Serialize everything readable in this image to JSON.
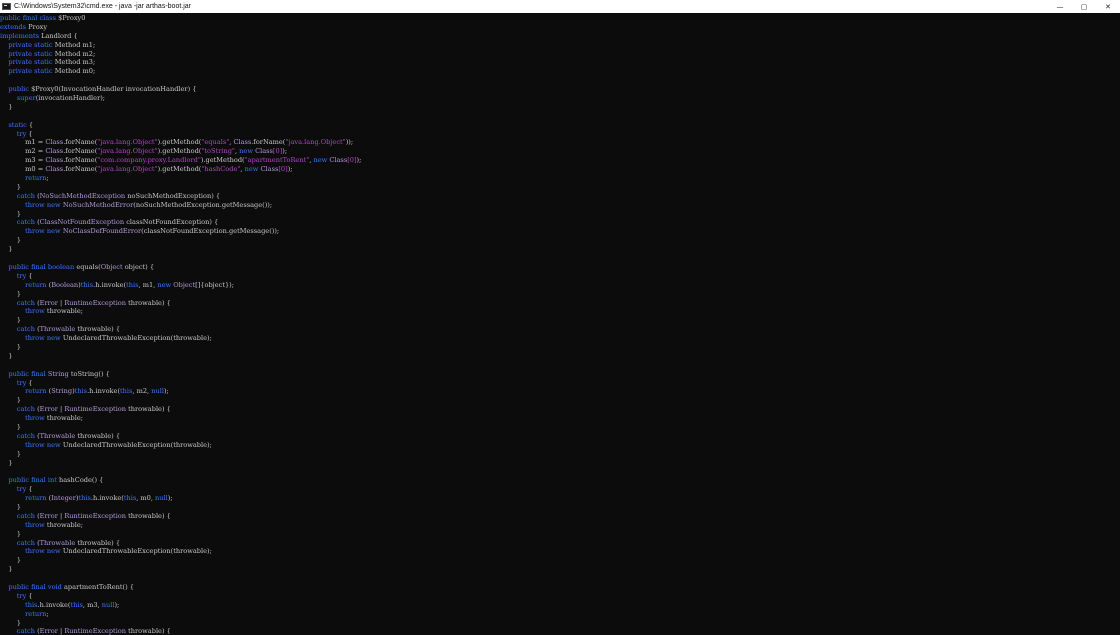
{
  "window": {
    "title": "C:\\Windows\\System32\\cmd.exe - java  -jar arthas-boot.jar",
    "controls": {
      "minimize": "—",
      "maximize": "▢",
      "close": "✕"
    }
  },
  "colors": {
    "keyword": "#3b78ff",
    "string": "#b148c6",
    "type": "#b49cdc",
    "plain": "#c8c8c8",
    "background": "#0c0c0c"
  },
  "code_lines": [
    [
      [
        "k",
        "public final class "
      ],
      [
        "p",
        "$Proxy0"
      ]
    ],
    [
      [
        "k",
        "extends "
      ],
      [
        "p",
        "Proxy"
      ]
    ],
    [
      [
        "k",
        "implements "
      ],
      [
        "p",
        "Landlord {"
      ]
    ],
    [
      [
        "k",
        "    private static "
      ],
      [
        "p",
        "Method m1;"
      ]
    ],
    [
      [
        "k",
        "    private static "
      ],
      [
        "p",
        "Method m2;"
      ]
    ],
    [
      [
        "k",
        "    private static "
      ],
      [
        "p",
        "Method m3;"
      ]
    ],
    [
      [
        "k",
        "    private static "
      ],
      [
        "p",
        "Method m0;"
      ]
    ],
    [],
    [
      [
        "k",
        "    public "
      ],
      [
        "p",
        "$Proxy0(InvocationHandler invocationHandler) {"
      ]
    ],
    [
      [
        "k",
        "        super"
      ],
      [
        "p",
        "(invocationHandler);"
      ]
    ],
    [
      [
        "p",
        "    }"
      ]
    ],
    [],
    [
      [
        "k",
        "    static "
      ],
      [
        "p",
        "{"
      ]
    ],
    [
      [
        "k",
        "        try "
      ],
      [
        "p",
        "{"
      ]
    ],
    [
      [
        "p",
        "            m1 = "
      ],
      [
        "t",
        "Class"
      ],
      [
        "p",
        ".forName("
      ],
      [
        "s",
        "\"java.lang.Object\""
      ],
      [
        "p",
        ").getMethod("
      ],
      [
        "s",
        "\"equals\""
      ],
      [
        "p",
        ", "
      ],
      [
        "t",
        "Class"
      ],
      [
        "p",
        ".forName("
      ],
      [
        "s",
        "\"java.lang.Object\""
      ],
      [
        "p",
        "));"
      ]
    ],
    [
      [
        "p",
        "            m2 = "
      ],
      [
        "t",
        "Class"
      ],
      [
        "p",
        ".forName("
      ],
      [
        "s",
        "\"java.lang.Object\""
      ],
      [
        "p",
        ").getMethod("
      ],
      [
        "s",
        "\"toString\""
      ],
      [
        "p",
        ", "
      ],
      [
        "k",
        "new "
      ],
      [
        "t",
        "Class"
      ],
      [
        "s",
        "[0]"
      ],
      [
        "p",
        ");"
      ]
    ],
    [
      [
        "p",
        "            m3 = "
      ],
      [
        "t",
        "Class"
      ],
      [
        "p",
        ".forName("
      ],
      [
        "s",
        "\"com.company.proxy.Landlord\""
      ],
      [
        "p",
        ").getMethod("
      ],
      [
        "s",
        "\"apartmentToRent\""
      ],
      [
        "p",
        ", "
      ],
      [
        "k",
        "new "
      ],
      [
        "t",
        "Class"
      ],
      [
        "s",
        "[0]"
      ],
      [
        "p",
        ");"
      ]
    ],
    [
      [
        "p",
        "            m0 = "
      ],
      [
        "t",
        "Class"
      ],
      [
        "p",
        ".forName("
      ],
      [
        "s",
        "\"java.lang.Object\""
      ],
      [
        "p",
        ").getMethod("
      ],
      [
        "s",
        "\"hashCode\""
      ],
      [
        "p",
        ", "
      ],
      [
        "k",
        "new "
      ],
      [
        "t",
        "Class"
      ],
      [
        "s",
        "[0]"
      ],
      [
        "p",
        ");"
      ]
    ],
    [
      [
        "k",
        "            return"
      ],
      [
        "p",
        ";"
      ]
    ],
    [
      [
        "p",
        "        }"
      ]
    ],
    [
      [
        "k",
        "        catch "
      ],
      [
        "p",
        "("
      ],
      [
        "t",
        "NoSuchMethodException"
      ],
      [
        "p",
        " noSuchMethodException) {"
      ]
    ],
    [
      [
        "k",
        "            throw new "
      ],
      [
        "t",
        "NoSuchMethodError"
      ],
      [
        "p",
        "(noSuchMethodException.getMessage());"
      ]
    ],
    [
      [
        "p",
        "        }"
      ]
    ],
    [
      [
        "k",
        "        catch "
      ],
      [
        "p",
        "("
      ],
      [
        "t",
        "ClassNotFoundException"
      ],
      [
        "p",
        " classNotFoundException) {"
      ]
    ],
    [
      [
        "k",
        "            throw new "
      ],
      [
        "t",
        "NoClassDefFoundError"
      ],
      [
        "p",
        "(classNotFoundException.getMessage());"
      ]
    ],
    [
      [
        "p",
        "        }"
      ]
    ],
    [
      [
        "p",
        "    }"
      ]
    ],
    [],
    [
      [
        "k",
        "    public final boolean "
      ],
      [
        "p",
        "equals("
      ],
      [
        "t",
        "Object"
      ],
      [
        "p",
        " object) {"
      ]
    ],
    [
      [
        "k",
        "        try "
      ],
      [
        "p",
        "{"
      ]
    ],
    [
      [
        "k",
        "            return "
      ],
      [
        "p",
        "("
      ],
      [
        "t",
        "Boolean"
      ],
      [
        "p",
        ")"
      ],
      [
        "k",
        "this"
      ],
      [
        "p",
        ".h.invoke("
      ],
      [
        "k",
        "this"
      ],
      [
        "p",
        ", m1, "
      ],
      [
        "k",
        "new "
      ],
      [
        "t",
        "Object"
      ],
      [
        "p",
        "[]{object});"
      ]
    ],
    [
      [
        "p",
        "        }"
      ]
    ],
    [
      [
        "k",
        "        catch "
      ],
      [
        "p",
        "("
      ],
      [
        "t",
        "Error"
      ],
      [
        "p",
        " | "
      ],
      [
        "t",
        "RuntimeException"
      ],
      [
        "p",
        " throwable) {"
      ]
    ],
    [
      [
        "k",
        "            throw "
      ],
      [
        "p",
        "throwable;"
      ]
    ],
    [
      [
        "p",
        "        }"
      ]
    ],
    [
      [
        "k",
        "        catch "
      ],
      [
        "p",
        "("
      ],
      [
        "t",
        "Throwable"
      ],
      [
        "p",
        " throwable) {"
      ]
    ],
    [
      [
        "k",
        "            throw new "
      ],
      [
        "p",
        "UndeclaredThrowableException(throwable);"
      ]
    ],
    [
      [
        "p",
        "        }"
      ]
    ],
    [
      [
        "p",
        "    }"
      ]
    ],
    [],
    [
      [
        "k",
        "    public final "
      ],
      [
        "t",
        "String "
      ],
      [
        "p",
        "toString() {"
      ]
    ],
    [
      [
        "k",
        "        try "
      ],
      [
        "p",
        "{"
      ]
    ],
    [
      [
        "k",
        "            return "
      ],
      [
        "p",
        "("
      ],
      [
        "t",
        "String"
      ],
      [
        "p",
        ")"
      ],
      [
        "k",
        "this"
      ],
      [
        "p",
        ".h.invoke("
      ],
      [
        "k",
        "this"
      ],
      [
        "p",
        ", m2, "
      ],
      [
        "k",
        "null"
      ],
      [
        "p",
        ");"
      ]
    ],
    [
      [
        "p",
        "        }"
      ]
    ],
    [
      [
        "k",
        "        catch "
      ],
      [
        "p",
        "("
      ],
      [
        "t",
        "Error"
      ],
      [
        "p",
        " | "
      ],
      [
        "t",
        "RuntimeException"
      ],
      [
        "p",
        " throwable) {"
      ]
    ],
    [
      [
        "k",
        "            throw "
      ],
      [
        "p",
        "throwable;"
      ]
    ],
    [
      [
        "p",
        "        }"
      ]
    ],
    [
      [
        "k",
        "        catch "
      ],
      [
        "p",
        "("
      ],
      [
        "t",
        "Throwable"
      ],
      [
        "p",
        " throwable) {"
      ]
    ],
    [
      [
        "k",
        "            throw new "
      ],
      [
        "p",
        "UndeclaredThrowableException(throwable);"
      ]
    ],
    [
      [
        "p",
        "        }"
      ]
    ],
    [
      [
        "p",
        "    }"
      ]
    ],
    [],
    [
      [
        "k",
        "    public final int "
      ],
      [
        "p",
        "hashCode() {"
      ]
    ],
    [
      [
        "k",
        "        try "
      ],
      [
        "p",
        "{"
      ]
    ],
    [
      [
        "k",
        "            return "
      ],
      [
        "p",
        "("
      ],
      [
        "t",
        "Integer"
      ],
      [
        "p",
        ")"
      ],
      [
        "k",
        "this"
      ],
      [
        "p",
        ".h.invoke("
      ],
      [
        "k",
        "this"
      ],
      [
        "p",
        ", m0, "
      ],
      [
        "k",
        "null"
      ],
      [
        "p",
        ");"
      ]
    ],
    [
      [
        "p",
        "        }"
      ]
    ],
    [
      [
        "k",
        "        catch "
      ],
      [
        "p",
        "("
      ],
      [
        "t",
        "Error"
      ],
      [
        "p",
        " | "
      ],
      [
        "t",
        "RuntimeException"
      ],
      [
        "p",
        " throwable) {"
      ]
    ],
    [
      [
        "k",
        "            throw "
      ],
      [
        "p",
        "throwable;"
      ]
    ],
    [
      [
        "p",
        "        }"
      ]
    ],
    [
      [
        "k",
        "        catch "
      ],
      [
        "p",
        "("
      ],
      [
        "t",
        "Throwable"
      ],
      [
        "p",
        " throwable) {"
      ]
    ],
    [
      [
        "k",
        "            throw new "
      ],
      [
        "p",
        "UndeclaredThrowableException(throwable);"
      ]
    ],
    [
      [
        "p",
        "        }"
      ]
    ],
    [
      [
        "p",
        "    }"
      ]
    ],
    [],
    [
      [
        "k",
        "    public final void "
      ],
      [
        "p",
        "apartmentToRent() {"
      ]
    ],
    [
      [
        "k",
        "        try "
      ],
      [
        "p",
        "{"
      ]
    ],
    [
      [
        "k",
        "            this"
      ],
      [
        "p",
        ".h.invoke("
      ],
      [
        "k",
        "this"
      ],
      [
        "p",
        ", m3, "
      ],
      [
        "k",
        "null"
      ],
      [
        "p",
        ");"
      ]
    ],
    [
      [
        "k",
        "            return"
      ],
      [
        "p",
        ";"
      ]
    ],
    [
      [
        "p",
        "        }"
      ]
    ],
    [
      [
        "k",
        "        catch "
      ],
      [
        "p",
        "("
      ],
      [
        "t",
        "Error"
      ],
      [
        "p",
        " | "
      ],
      [
        "t",
        "RuntimeException"
      ],
      [
        "p",
        " throwable) {"
      ]
    ]
  ]
}
